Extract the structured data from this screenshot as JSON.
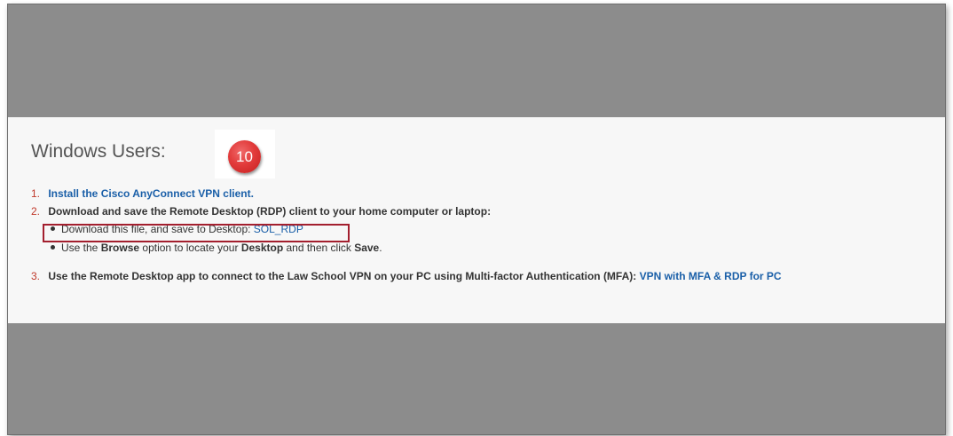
{
  "section": {
    "heading": "Windows Users:",
    "step_badge": "10"
  },
  "steps": [
    {
      "number": "1.",
      "link_text": "Install the Cisco AnyConnect VPN client."
    },
    {
      "number": "2.",
      "text": "Download and save the Remote Desktop (RDP) client to your home computer or laptop:",
      "substeps": [
        {
          "text": "Download this file, and save to Desktop: ",
          "link_text": "SOL_RDP"
        },
        {
          "pre": "Use the ",
          "bold1": "Browse",
          "mid": " option to locate your ",
          "bold2": "Desktop",
          "mid2": " and then click ",
          "bold3": "Save",
          "post": "."
        }
      ]
    },
    {
      "number": "3.",
      "text": "Use the Remote Desktop app to connect to the Law School VPN on your PC using Multi-factor Authentication (MFA): ",
      "link_text": "VPN with MFA & RDP for PC"
    }
  ],
  "colors": {
    "link": "#1a5fa8",
    "step_number": "#c0392b",
    "highlight_border": "#a31f2e",
    "badge": "#e23b3b",
    "background_band": "#8c8c8c"
  }
}
